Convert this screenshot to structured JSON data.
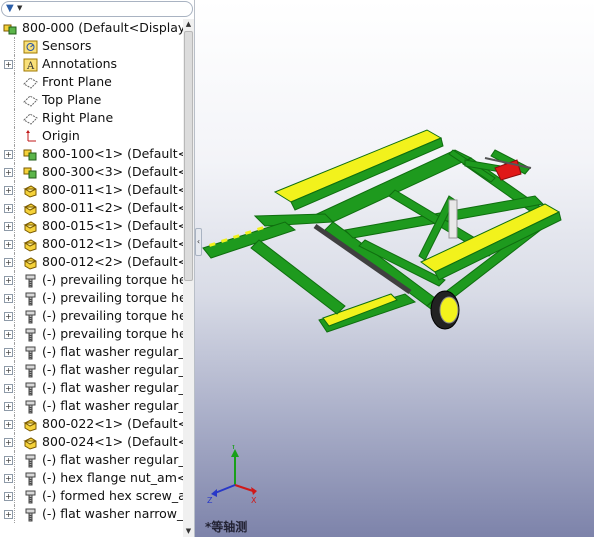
{
  "filter": {
    "icon": "funnel-icon"
  },
  "tree": {
    "items": [
      {
        "label": "800-000  (Default<Display",
        "icon": "assembly-icon",
        "expander": "",
        "indent": 0
      },
      {
        "label": "Sensors",
        "icon": "sensor-icon",
        "expander": "",
        "indent": 1
      },
      {
        "label": "Annotations",
        "icon": "annotation-icon",
        "expander": "+",
        "indent": 1
      },
      {
        "label": "Front Plane",
        "icon": "plane-icon",
        "expander": "",
        "indent": 1
      },
      {
        "label": "Top Plane",
        "icon": "plane-icon",
        "expander": "",
        "indent": 1
      },
      {
        "label": "Right Plane",
        "icon": "plane-icon",
        "expander": "",
        "indent": 1
      },
      {
        "label": "Origin",
        "icon": "origin-icon",
        "expander": "",
        "indent": 1
      },
      {
        "label": "800-100<1> (Default<D",
        "icon": "subassembly-icon",
        "expander": "+",
        "indent": 1
      },
      {
        "label": "800-300<3> (Default<D",
        "icon": "subassembly-icon",
        "expander": "+",
        "indent": 1
      },
      {
        "label": "800-011<1> (Default<<",
        "icon": "part-icon",
        "expander": "+",
        "indent": 1
      },
      {
        "label": "800-011<2> (Default<<",
        "icon": "part-icon",
        "expander": "+",
        "indent": 1
      },
      {
        "label": "800-015<1> (Default<<",
        "icon": "part-icon",
        "expander": "+",
        "indent": 1
      },
      {
        "label": "800-012<1> (Default<<",
        "icon": "part-icon",
        "expander": "+",
        "indent": 1
      },
      {
        "label": "800-012<2> (Default<<",
        "icon": "part-icon",
        "expander": "+",
        "indent": 1
      },
      {
        "label": "(-) prevailing torque hex",
        "icon": "toolbox-bolt-icon",
        "expander": "+",
        "indent": 1
      },
      {
        "label": "(-) prevailing torque hex",
        "icon": "toolbox-bolt-icon",
        "expander": "+",
        "indent": 1
      },
      {
        "label": "(-) prevailing torque hex",
        "icon": "toolbox-bolt-icon",
        "expander": "+",
        "indent": 1
      },
      {
        "label": "(-) prevailing torque hex",
        "icon": "toolbox-bolt-icon",
        "expander": "+",
        "indent": 1
      },
      {
        "label": "(-) flat washer regular_a",
        "icon": "toolbox-bolt-icon",
        "expander": "+",
        "indent": 1
      },
      {
        "label": "(-) flat washer regular_a",
        "icon": "toolbox-bolt-icon",
        "expander": "+",
        "indent": 1
      },
      {
        "label": "(-) flat washer regular_a",
        "icon": "toolbox-bolt-icon",
        "expander": "+",
        "indent": 1
      },
      {
        "label": "(-) flat washer regular_a",
        "icon": "toolbox-bolt-icon",
        "expander": "+",
        "indent": 1
      },
      {
        "label": "800-022<1> (Default<<",
        "icon": "part-icon",
        "expander": "+",
        "indent": 1
      },
      {
        "label": "800-024<1> (Default<<",
        "icon": "part-icon",
        "expander": "+",
        "indent": 1
      },
      {
        "label": "(-) flat washer regular_a",
        "icon": "toolbox-bolt-icon",
        "expander": "+",
        "indent": 1
      },
      {
        "label": "(-) hex flange nut_am<2",
        "icon": "toolbox-bolt-icon",
        "expander": "+",
        "indent": 1
      },
      {
        "label": "(-) formed hex screw_ar",
        "icon": "toolbox-bolt-icon",
        "expander": "+",
        "indent": 1
      },
      {
        "label": "(-) flat washer narrow_a",
        "icon": "toolbox-bolt-icon",
        "expander": "+",
        "indent": 1
      }
    ]
  },
  "viewport": {
    "view_name": "*等轴测",
    "triad": {
      "x": "X",
      "y": "Y",
      "z": "Z"
    }
  },
  "colors": {
    "frame_green": "#1e9a1e",
    "deck_yellow": "#f2f21c",
    "accent_red": "#e01818"
  }
}
